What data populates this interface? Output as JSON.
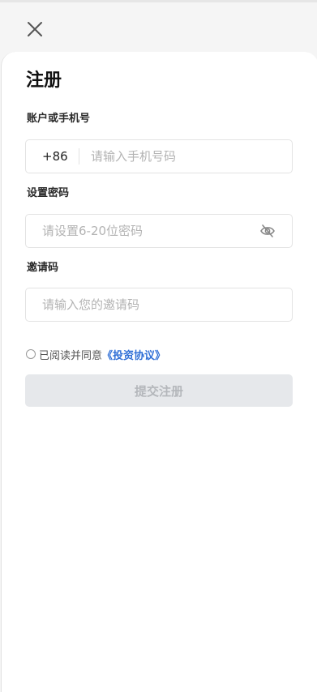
{
  "header": {
    "close_icon": "close-icon"
  },
  "form": {
    "title": "注册",
    "account": {
      "label": "账户或手机号",
      "country_code": "+86",
      "placeholder": "请输入手机号码",
      "value": ""
    },
    "password": {
      "label": "设置密码",
      "placeholder": "请设置6-20位密码",
      "value": "",
      "toggle_icon": "eye-off-icon"
    },
    "invite": {
      "label": "邀请码",
      "placeholder": "请输入您的邀请码",
      "value": ""
    },
    "agreement": {
      "prefix": "已阅读并同意",
      "link": "《投资协议》",
      "checked": false
    },
    "submit_label": "提交注册"
  },
  "colors": {
    "link": "#2f6fd6",
    "button_disabled_bg": "#e6e8eb",
    "button_disabled_text": "#b4b7bb",
    "border": "#e3e3e3"
  }
}
